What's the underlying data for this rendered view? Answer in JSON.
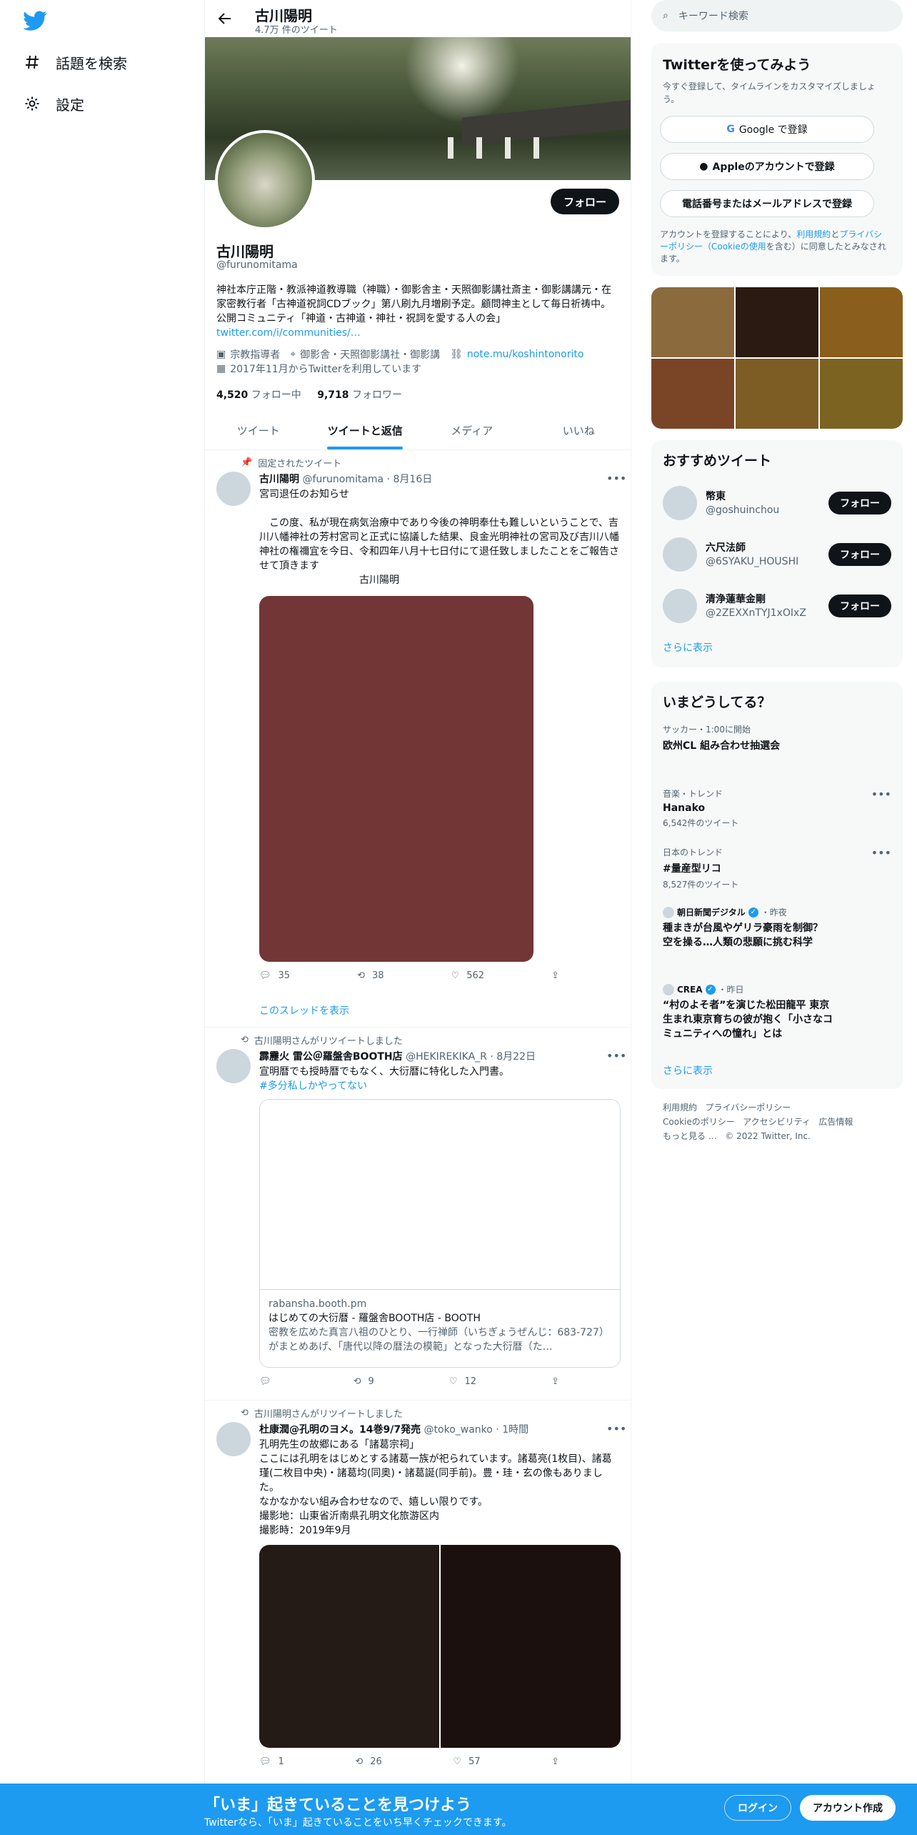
{
  "colors": {
    "accent": "#1d9bf0",
    "dark": "#0f1419",
    "muted": "#536471"
  },
  "nav": {
    "explore": "話題を検索",
    "settings": "設定"
  },
  "topbar": {
    "name": "古川陽明",
    "tweet_count": "4.7万 件のツイート"
  },
  "profile": {
    "follow": "フォロー",
    "name": "古川陽明",
    "handle": "@furunomitama",
    "bio": "神社本庁正階・教派神道教導職（神職）・御影舎主・天照御影講社斎主・御影講講元・在家密教行者「古神道祝詞CDブック」第八刷九月増刷予定。顧問神主として毎日祈祷中。公開コミュニティ「神道・古神道・神社・祝詞を愛する人の会」",
    "bio_link": "twitter.com/i/communities/…",
    "category": "宗教指導者",
    "location": "御影舎・天照御影講社・御影講",
    "url": "note.mu/koshintonorito",
    "joined": "2017年11月からTwitterを利用しています",
    "following_count": "4,520",
    "following_label": "フォロー中",
    "followers_count": "9,718",
    "followers_label": "フォロワー"
  },
  "tabs": [
    "ツイート",
    "ツイートと返信",
    "メディア",
    "いいね"
  ],
  "tweets": [
    {
      "context": "固定されたツイート",
      "name": "古川陽明",
      "handle": "@furunomitama",
      "date": "8月16日",
      "text": "宮司退任のお知らせ\n\n　この度、私が現在病気治療中であり今後の神明奉仕も難しいということで、吉川八幡神社の芳村宮司と正式に協議した結果、良金光明神社の宮司及び吉川八幡神社の権禰宜を今日、令和四年八月十七日付にて退任致しましたことをご報告させて頂きます\n　　　　　　　　　　古川陽明",
      "media_color": "#733636",
      "replies": "35",
      "retweets": "38",
      "likes": "562",
      "show_thread": "このスレッドを表示"
    },
    {
      "context": "古川陽明さんがリツイートしました",
      "name": "霹靂火 雷公＠羅盤舎BOOTH店",
      "handle": "@HEKIREKIKA_R",
      "date": "8月22日",
      "text": "宣明暦でも授時暦でもなく、大衍暦に特化した入門書。",
      "hashtag": "#多分私しかやってない",
      "card_domain": "rabansha.booth.pm",
      "card_title": "はじめての大衍暦 - 羅盤舎BOOTH店 - BOOTH",
      "card_desc": "密教を広めた真言八祖のひとり、一行禅師（いちぎょうぜんじ：683-727）がまとめあげ、「唐代以降の暦法の模範」となった大衍暦（た…",
      "replies": "",
      "retweets": "9",
      "likes": "12"
    },
    {
      "context": "古川陽明さんがリツイートしました",
      "name": "杜康潤@孔明のヨメ。14巻9/7発売",
      "handle": "@toko_wanko",
      "date": "1時間",
      "text": "孔明先生の故郷にある「諸葛宗祠」\nここには孔明をはじめとする諸葛一族が祀られています。諸葛亮(1枚目)、諸葛瑾(二枚目中央)・諸葛均(同奥)・諸葛誕(同手前)。豊・珪・玄の像もありました。\nなかなかない組み合わせなので、嬉しい限りです。\n撮影地：山東省沂南県孔明文化旅游区内\n撮影時：2019年9月",
      "media_colors": [
        "#241a16",
        "#1c100e"
      ],
      "replies": "1",
      "retweets": "26",
      "likes": "57"
    }
  ],
  "right": {
    "search_placeholder": "キーワード検索",
    "signup": {
      "title": "Twitterを使ってみよう",
      "desc": "今すぐ登録して、タイムラインをカスタマイズしましょう。",
      "google": "Google で登録",
      "apple": "Appleのアカウントで登録",
      "phone": "電話番号またはメールアドレスで登録",
      "terms": "アカウントを登録することにより、",
      "terms_link1": "利用規約",
      "terms_and": "と",
      "terms_link2": "プライバシーポリシー（Cookieの使用",
      "terms_end": "を含む）に同意したとみなされます。"
    },
    "media_colors": [
      "#8b6a3e",
      "#2a1a12",
      "#8a5e1c",
      "#7a4526",
      "#7d5d24",
      "#7c6322"
    ],
    "recommended": {
      "title": "おすすめツイート",
      "follow": "フォロー",
      "more": "さらに表示",
      "users": [
        {
          "name": "幣東",
          "handle": "@goshuinchou"
        },
        {
          "name": "六尺法師",
          "handle": "@6SYAKU_HOUSHI"
        },
        {
          "name": "清浄蓮華金剛",
          "handle": "@2ZEXXnTYJ1xOIxZ"
        }
      ]
    },
    "trends": {
      "title": "いまどうしてる？",
      "items": [
        {
          "category": "サッカー・1:00に開始",
          "title": "欧州CL 組み合わせ抽選会",
          "count": ""
        },
        {
          "category": "音楽・トレンド",
          "title": "Hanako",
          "count": "6,542件のツイート"
        },
        {
          "category": "日本のトレンド",
          "title": "#量産型リコ",
          "count": "8,527件のツイート"
        }
      ],
      "news": [
        {
          "source": "朝日新聞デジタル",
          "time": "・昨夜",
          "headline": "種まきが台風やゲリラ豪雨を制御？　空を操る…人類の悲願に挑む科学"
        },
        {
          "source": "CREA",
          "time": "・昨日",
          "headline": "“村のよそ者”を演じた松田龍平 東京生まれ東京育ちの彼が抱く「小さなコミュニティへの憧れ」とは"
        }
      ],
      "more": "さらに表示"
    },
    "footer": {
      "l1": "利用規約",
      "l2": "プライバシーポリシー",
      "l3": "Cookieのポリシー",
      "l4": "アクセシビリティ",
      "l5": "広告情報",
      "l6": "もっと見る …",
      "copy": "© 2022 Twitter, Inc."
    }
  },
  "bottom": {
    "headline": "「いま」起きていることを見つけよう",
    "sub": "Twitterなら、「いま」起きていることをいち早くチェックできます。",
    "login": "ログイン",
    "signup": "アカウント作成"
  }
}
